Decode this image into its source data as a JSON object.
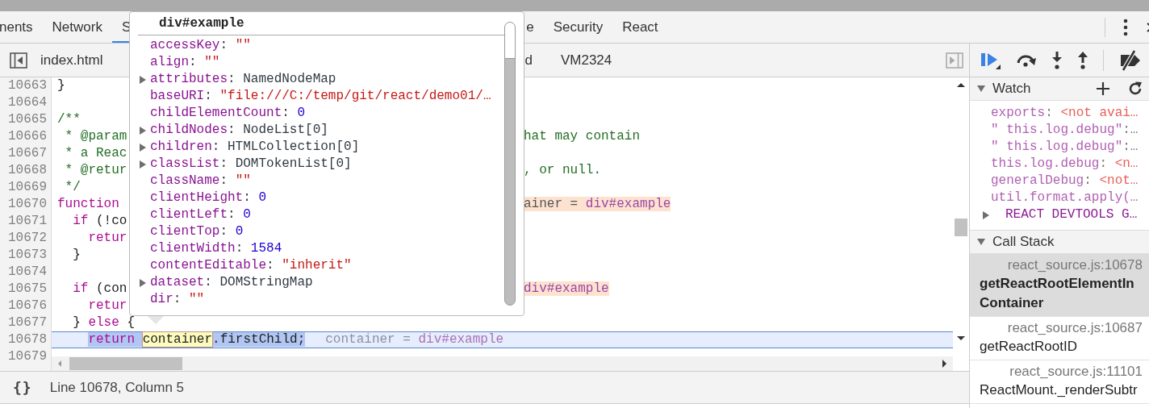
{
  "main_tabs": [
    {
      "label": "nents",
      "selected": false
    },
    {
      "label": "Network",
      "selected": false
    },
    {
      "label": "S",
      "selected": true
    },
    {
      "label": "e",
      "selected": false
    },
    {
      "label": "Security",
      "selected": false
    },
    {
      "label": "React",
      "selected": false
    }
  ],
  "file_tabs": [
    {
      "label": "index.html"
    },
    {
      "label": "d"
    },
    {
      "label": "VM2324"
    }
  ],
  "code": {
    "lines": [
      {
        "number": "10663",
        "current": false,
        "left": [
          {
            "kind": "plain",
            "text": "}"
          }
        ]
      },
      {
        "number": "10664",
        "current": false
      },
      {
        "number": "10665",
        "current": false,
        "left": [
          {
            "kind": "comment",
            "text": "/**"
          }
        ]
      },
      {
        "number": "10666",
        "current": false,
        "left": [
          {
            "kind": "comment",
            "text": " * @param"
          }
        ],
        "right": [
          {
            "kind": "comment",
            "text": "hat may contain"
          }
        ]
      },
      {
        "number": "10667",
        "current": false,
        "left": [
          {
            "kind": "comment",
            "text": " * a Reac"
          }
        ]
      },
      {
        "number": "10668",
        "current": false,
        "left": [
          {
            "kind": "comment",
            "text": " * @retur"
          }
        ],
        "right": [
          {
            "kind": "comment",
            "text": ", or null."
          }
        ]
      },
      {
        "number": "10669",
        "current": false,
        "left": [
          {
            "kind": "comment",
            "text": " */"
          }
        ]
      },
      {
        "number": "10670",
        "current": false,
        "left": [
          {
            "kind": "keyword",
            "text": "function"
          }
        ],
        "right": [
          {
            "kind": "inline-name",
            "text": "ainer = "
          },
          {
            "kind": "inline-value",
            "text": "div#example"
          }
        ]
      },
      {
        "number": "10671",
        "current": false,
        "left": [
          {
            "kind": "keyword",
            "text": "  if"
          },
          {
            "kind": "plain",
            "text": " (!co"
          }
        ]
      },
      {
        "number": "10672",
        "current": false,
        "left": [
          {
            "kind": "keyword",
            "text": "    retur"
          }
        ]
      },
      {
        "number": "10673",
        "current": false,
        "left": [
          {
            "kind": "plain",
            "text": "  }"
          }
        ]
      },
      {
        "number": "10674",
        "current": false
      },
      {
        "number": "10675",
        "current": false,
        "left": [
          {
            "kind": "keyword",
            "text": "  if"
          },
          {
            "kind": "plain",
            "text": " (con"
          }
        ],
        "right": [
          {
            "kind": "inline-value",
            "text": "div#example"
          }
        ]
      },
      {
        "number": "10676",
        "current": false,
        "left": [
          {
            "kind": "keyword",
            "text": "    retur"
          }
        ]
      },
      {
        "number": "10677",
        "current": false,
        "left": [
          {
            "kind": "plain",
            "text": "  } "
          },
          {
            "kind": "keyword",
            "text": "else"
          },
          {
            "kind": "plain",
            "text": " {"
          }
        ]
      },
      {
        "number": "10678",
        "current": true,
        "left": [
          {
            "kind": "keyword",
            "text": "    return "
          },
          {
            "kind": "token",
            "text": "container"
          },
          {
            "kind": "plain",
            "text": ".firstChild;"
          },
          {
            "kind": "hint",
            "text": "container = "
          },
          {
            "kind": "hint-value",
            "text": "div#example"
          }
        ]
      },
      {
        "number": "10679",
        "current": false
      }
    ]
  },
  "status_bar": {
    "format_button": "{}",
    "position": "Line 10678, Column 5"
  },
  "popup": {
    "title": "div#example",
    "properties": [
      {
        "expandable": false,
        "name": "accessKey",
        "sep": ": ",
        "value": "\"\"",
        "kind": "string"
      },
      {
        "expandable": false,
        "name": "align",
        "sep": ": ",
        "value": "\"\"",
        "kind": "string"
      },
      {
        "expandable": true,
        "name": "attributes",
        "sep": ": ",
        "value": "NamedNodeMap",
        "kind": "object"
      },
      {
        "expandable": false,
        "name": "baseURI",
        "sep": ": ",
        "value": "\"file:///C:/temp/git/react/demo01/…",
        "kind": "string"
      },
      {
        "expandable": false,
        "name": "childElementCount",
        "sep": ": ",
        "value": "0",
        "kind": "number"
      },
      {
        "expandable": true,
        "name": "childNodes",
        "sep": ": ",
        "value": "NodeList[0]",
        "kind": "object"
      },
      {
        "expandable": true,
        "name": "children",
        "sep": ": ",
        "value": "HTMLCollection[0]",
        "kind": "object"
      },
      {
        "expandable": true,
        "name": "classList",
        "sep": ": ",
        "value": "DOMTokenList[0]",
        "kind": "object"
      },
      {
        "expandable": false,
        "name": "className",
        "sep": ": ",
        "value": "\"\"",
        "kind": "string"
      },
      {
        "expandable": false,
        "name": "clientHeight",
        "sep": ": ",
        "value": "0",
        "kind": "number"
      },
      {
        "expandable": false,
        "name": "clientLeft",
        "sep": ": ",
        "value": "0",
        "kind": "number"
      },
      {
        "expandable": false,
        "name": "clientTop",
        "sep": ": ",
        "value": "0",
        "kind": "number"
      },
      {
        "expandable": false,
        "name": "clientWidth",
        "sep": ": ",
        "value": "1584",
        "kind": "number"
      },
      {
        "expandable": false,
        "name": "contentEditable",
        "sep": ": ",
        "value": "\"inherit\"",
        "kind": "string"
      },
      {
        "expandable": true,
        "name": "dataset",
        "sep": ": ",
        "value": "DOMStringMap",
        "kind": "object"
      },
      {
        "expandable": false,
        "name": "dir",
        "sep": ": ",
        "value": "\"\"",
        "kind": "string"
      }
    ]
  },
  "debugger": {
    "watch": {
      "title": "Watch",
      "expanded": true,
      "items": [
        {
          "expandable": false,
          "segments": [
            {
              "kind": "name",
              "text": "exports"
            },
            {
              "kind": "punct",
              "text": ": "
            },
            {
              "kind": "error",
              "text": "<not avai…"
            }
          ]
        },
        {
          "expandable": false,
          "segments": [
            {
              "kind": "name",
              "text": "\" this.log.debug\""
            },
            {
              "kind": "punct",
              "text": ":…"
            }
          ]
        },
        {
          "expandable": false,
          "segments": [
            {
              "kind": "name",
              "text": "\" this.log.debug\""
            },
            {
              "kind": "punct",
              "text": ":…"
            }
          ]
        },
        {
          "expandable": false,
          "segments": [
            {
              "kind": "name",
              "text": "this.log.debug"
            },
            {
              "kind": "punct",
              "text": ": "
            },
            {
              "kind": "error",
              "text": "<n…"
            }
          ]
        },
        {
          "expandable": false,
          "segments": [
            {
              "kind": "name",
              "text": "generalDebug"
            },
            {
              "kind": "punct",
              "text": ": "
            },
            {
              "kind": "error",
              "text": "<not…"
            }
          ]
        },
        {
          "expandable": false,
          "segments": [
            {
              "kind": "name",
              "text": "util.format.apply(…"
            }
          ]
        },
        {
          "expandable": true,
          "segments": [
            {
              "kind": "group",
              "text": "REACT DEVTOOLS G…"
            }
          ]
        }
      ]
    },
    "call_stack": {
      "title": "Call Stack",
      "expanded": true,
      "frames": [
        {
          "location": "react_source.js:10678",
          "function": "getReactRootElementInContainer",
          "selected": true
        },
        {
          "location": "react_source.js:10687",
          "function": "getReactRootID",
          "selected": false
        },
        {
          "location": "react_source.js:11101",
          "function": "ReactMount._renderSubtr",
          "selected": false
        }
      ]
    }
  }
}
